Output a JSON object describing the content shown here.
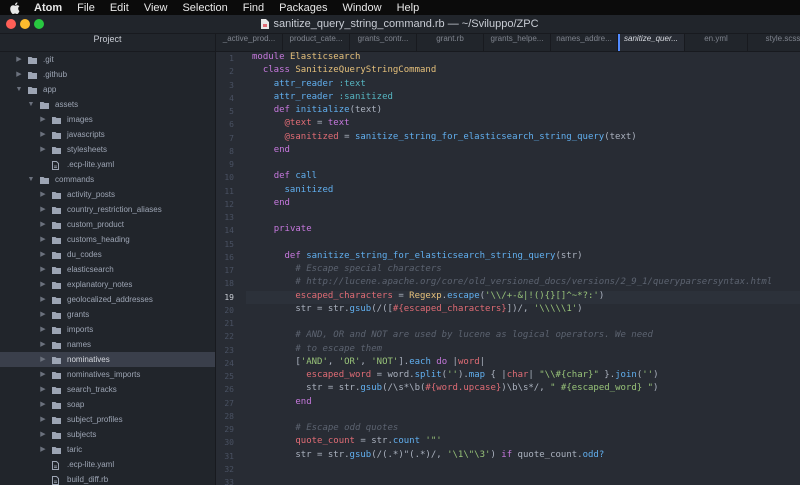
{
  "menubar": {
    "app_name": "Atom",
    "items": [
      "File",
      "Edit",
      "View",
      "Selection",
      "Find",
      "Packages",
      "Window",
      "Help"
    ]
  },
  "window": {
    "title": "sanitize_query_string_command.rb — ~/Sviluppo/ZPC",
    "traffic_lights": [
      "#ff5f57",
      "#febc2e",
      "#28c840"
    ]
  },
  "tree": {
    "header": "Project",
    "items": [
      {
        "name": ".git",
        "type": "folder",
        "depth": 0,
        "open": false
      },
      {
        "name": ".github",
        "type": "folder",
        "depth": 0,
        "open": false
      },
      {
        "name": "app",
        "type": "folder",
        "depth": 0,
        "open": true
      },
      {
        "name": "assets",
        "type": "folder",
        "depth": 1,
        "open": true
      },
      {
        "name": "images",
        "type": "folder",
        "depth": 2,
        "open": false
      },
      {
        "name": "javascripts",
        "type": "folder",
        "depth": 2,
        "open": false
      },
      {
        "name": "stylesheets",
        "type": "folder",
        "depth": 2,
        "open": false
      },
      {
        "name": ".ecp-lite.yaml",
        "type": "file",
        "depth": 2
      },
      {
        "name": "commands",
        "type": "folder",
        "depth": 1,
        "open": true
      },
      {
        "name": "activity_posts",
        "type": "folder",
        "depth": 2,
        "open": false
      },
      {
        "name": "country_restriction_aliases",
        "type": "folder",
        "depth": 2,
        "open": false
      },
      {
        "name": "custom_product",
        "type": "folder",
        "depth": 2,
        "open": false
      },
      {
        "name": "customs_heading",
        "type": "folder",
        "depth": 2,
        "open": false
      },
      {
        "name": "du_codes",
        "type": "folder",
        "depth": 2,
        "open": false
      },
      {
        "name": "elasticsearch",
        "type": "folder",
        "depth": 2,
        "open": false
      },
      {
        "name": "explanatory_notes",
        "type": "folder",
        "depth": 2,
        "open": false
      },
      {
        "name": "geolocalized_addresses",
        "type": "folder",
        "depth": 2,
        "open": false
      },
      {
        "name": "grants",
        "type": "folder",
        "depth": 2,
        "open": false
      },
      {
        "name": "imports",
        "type": "folder",
        "depth": 2,
        "open": false
      },
      {
        "name": "names",
        "type": "folder",
        "depth": 2,
        "open": false
      },
      {
        "name": "nominatives",
        "type": "folder",
        "depth": 2,
        "open": false,
        "selected": true
      },
      {
        "name": "nominatives_imports",
        "type": "folder",
        "depth": 2,
        "open": false
      },
      {
        "name": "search_tracks",
        "type": "folder",
        "depth": 2,
        "open": false
      },
      {
        "name": "soap",
        "type": "folder",
        "depth": 2,
        "open": false
      },
      {
        "name": "subject_profiles",
        "type": "folder",
        "depth": 2,
        "open": false
      },
      {
        "name": "subjects",
        "type": "folder",
        "depth": 2,
        "open": false
      },
      {
        "name": "taric",
        "type": "folder",
        "depth": 2,
        "open": false
      },
      {
        "name": ".ecp-lite.yaml",
        "type": "file",
        "depth": 2
      },
      {
        "name": "build_diff.rb",
        "type": "file",
        "depth": 2
      }
    ]
  },
  "tabs": [
    {
      "label": "_active_prod..."
    },
    {
      "label": "product_cate..."
    },
    {
      "label": "grants_contr..."
    },
    {
      "label": "grant.rb"
    },
    {
      "label": "grants_helpe..."
    },
    {
      "label": "names_addre..."
    },
    {
      "label": "sanitize_quer...",
      "active": true
    },
    {
      "label": "en.yml"
    },
    {
      "label": "style.scss"
    }
  ],
  "editor": {
    "current_line": 19,
    "lines": [
      [
        [
          "kw",
          "module "
        ],
        [
          "cn",
          "Elasticsearch"
        ]
      ],
      [
        [
          "pl",
          "  "
        ],
        [
          "kw",
          "class "
        ],
        [
          "cn",
          "SanitizeQueryStringCommand"
        ]
      ],
      [
        [
          "pl",
          "    "
        ],
        [
          "fn",
          "attr_reader "
        ],
        [
          "sy",
          ":text"
        ]
      ],
      [
        [
          "pl",
          "    "
        ],
        [
          "fn",
          "attr_reader "
        ],
        [
          "sy",
          ":sanitized"
        ]
      ],
      [
        [
          "pl",
          "    "
        ],
        [
          "kw",
          "def "
        ],
        [
          "fn",
          "initialize"
        ],
        [
          "pl",
          "(text)"
        ]
      ],
      [
        [
          "pl",
          "      "
        ],
        [
          "iv",
          "@text"
        ],
        [
          "pl",
          " = "
        ],
        [
          "kw",
          "text"
        ]
      ],
      [
        [
          "pl",
          "      "
        ],
        [
          "iv",
          "@sanitized"
        ],
        [
          "pl",
          " = "
        ],
        [
          "fn",
          "sanitize_string_for_elasticsearch_string_query"
        ],
        [
          "pl",
          "(text)"
        ]
      ],
      [
        [
          "pl",
          "    "
        ],
        [
          "kw",
          "end"
        ]
      ],
      [],
      [
        [
          "pl",
          "    "
        ],
        [
          "kw",
          "def "
        ],
        [
          "fn",
          "call"
        ]
      ],
      [
        [
          "pl",
          "      "
        ],
        [
          "fn",
          "sanitized"
        ]
      ],
      [
        [
          "pl",
          "    "
        ],
        [
          "kw",
          "end"
        ]
      ],
      [],
      [
        [
          "pl",
          "    "
        ],
        [
          "kw",
          "private"
        ]
      ],
      [],
      [
        [
          "pl",
          "      "
        ],
        [
          "kw",
          "def "
        ],
        [
          "fn",
          "sanitize_string_for_elasticsearch_string_query"
        ],
        [
          "pl",
          "(str)"
        ]
      ],
      [
        [
          "pl",
          "        "
        ],
        [
          "cm",
          "# Escape special characters"
        ]
      ],
      [
        [
          "pl",
          "        "
        ],
        [
          "cm",
          "# http://lucene.apache.org/core/old_versioned_docs/versions/2_9_1/queryparsersyntax.html"
        ]
      ],
      [
        [
          "pl",
          "        "
        ],
        [
          "iv",
          "escaped_characters"
        ],
        [
          "pl",
          " = "
        ],
        [
          "cn",
          "Regexp"
        ],
        [
          "pl",
          "."
        ],
        [
          "fn",
          "escape"
        ],
        [
          "pl",
          "("
        ],
        [
          "st",
          "'\\\\/+-&|!(){}[]^~*?:'"
        ],
        [
          "pl",
          ")"
        ]
      ],
      [
        [
          "pl",
          "        str = str."
        ],
        [
          "fn",
          "gsub"
        ],
        [
          "pl",
          "(/(["
        ],
        [
          "iv",
          "#{escaped_characters}"
        ],
        [
          "pl",
          "])/, "
        ],
        [
          "st",
          "'\\\\\\\\\\1'"
        ],
        [
          "pl",
          ")"
        ]
      ],
      [],
      [
        [
          "pl",
          "        "
        ],
        [
          "cm",
          "# AND, OR and NOT are used by lucene as logical operators. We need"
        ]
      ],
      [
        [
          "pl",
          "        "
        ],
        [
          "cm",
          "# to escape them"
        ]
      ],
      [
        [
          "pl",
          "        ["
        ],
        [
          "st",
          "'AND'"
        ],
        [
          "pl",
          ", "
        ],
        [
          "st",
          "'OR'"
        ],
        [
          "pl",
          ", "
        ],
        [
          "st",
          "'NOT'"
        ],
        [
          "pl",
          "]."
        ],
        [
          "fn",
          "each"
        ],
        [
          "pl",
          " "
        ],
        [
          "kw",
          "do"
        ],
        [
          "pl",
          " |"
        ],
        [
          "iv",
          "word"
        ],
        [
          "pl",
          "|"
        ]
      ],
      [
        [
          "pl",
          "          "
        ],
        [
          "iv",
          "escaped_word"
        ],
        [
          "pl",
          " = word."
        ],
        [
          "fn",
          "split"
        ],
        [
          "pl",
          "("
        ],
        [
          "st",
          "''"
        ],
        [
          "pl",
          ")."
        ],
        [
          "fn",
          "map"
        ],
        [
          "pl",
          " { |"
        ],
        [
          "iv",
          "char"
        ],
        [
          "pl",
          "| "
        ],
        [
          "st",
          "\"\\\\#{char}\""
        ],
        [
          "pl",
          " }."
        ],
        [
          "fn",
          "join"
        ],
        [
          "pl",
          "("
        ],
        [
          "st",
          "''"
        ],
        [
          "pl",
          ")"
        ]
      ],
      [
        [
          "pl",
          "          str = str."
        ],
        [
          "fn",
          "gsub"
        ],
        [
          "pl",
          "(/\\s*\\b("
        ],
        [
          "iv",
          "#{word.upcase}"
        ],
        [
          "pl",
          ")\\b\\s*/, "
        ],
        [
          "st",
          "\" #{escaped_word} \""
        ],
        [
          "pl",
          ")"
        ]
      ],
      [
        [
          "pl",
          "        "
        ],
        [
          "kw",
          "end"
        ]
      ],
      [],
      [
        [
          "pl",
          "        "
        ],
        [
          "cm",
          "# Escape odd quotes"
        ]
      ],
      [
        [
          "pl",
          "        "
        ],
        [
          "iv",
          "quote_count"
        ],
        [
          "pl",
          " = str."
        ],
        [
          "fn",
          "count"
        ],
        [
          "pl",
          " "
        ],
        [
          "st",
          "'\"'"
        ]
      ],
      [
        [
          "pl",
          "        str = str."
        ],
        [
          "fn",
          "gsub"
        ],
        [
          "pl",
          "(/(.*)\"(.*)/, "
        ],
        [
          "st",
          "'\\1\\\"\\3'"
        ],
        [
          "pl",
          ") "
        ],
        [
          "kw",
          "if"
        ],
        [
          "pl",
          " quote_count."
        ],
        [
          "fn",
          "odd?"
        ]
      ],
      [],
      [],
      [
        []
      ]
    ]
  }
}
